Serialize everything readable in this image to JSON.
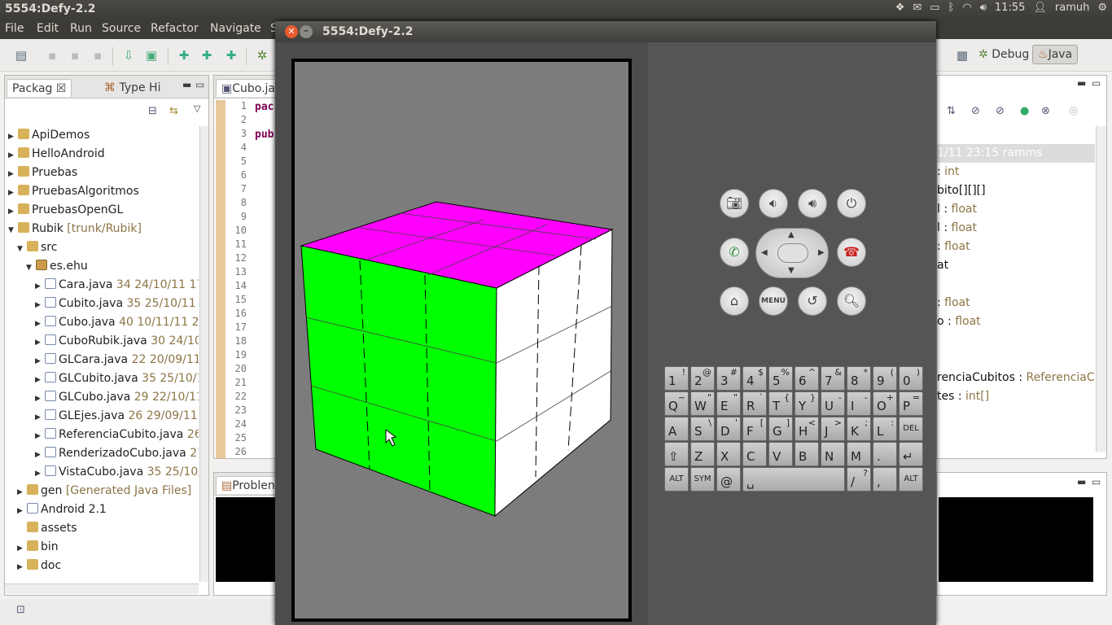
{
  "topbar": {
    "title": "5554:Defy-2.2",
    "clock": "11:55",
    "user": "ramuh"
  },
  "menu": [
    "File",
    "Edit",
    "Run",
    "Source",
    "Refactor",
    "Navigate",
    "S"
  ],
  "perspectives": {
    "debug": "Debug",
    "java": "Java"
  },
  "package_explorer": {
    "tab1": "Packag",
    "tab2": "Type Hi",
    "rows": [
      {
        "indent": 0,
        "twisty": "▶",
        "icon": "fold",
        "label": "ApiDemos",
        "deco": ""
      },
      {
        "indent": 0,
        "twisty": "▶",
        "icon": "fold",
        "label": "HelloAndroid",
        "deco": ""
      },
      {
        "indent": 0,
        "twisty": "▶",
        "icon": "fold",
        "label": "Pruebas",
        "deco": ""
      },
      {
        "indent": 0,
        "twisty": "▶",
        "icon": "fold",
        "label": "PruebasAlgoritmos",
        "deco": ""
      },
      {
        "indent": 0,
        "twisty": "▶",
        "icon": "fold",
        "label": "PruebasOpenGL",
        "deco": ""
      },
      {
        "indent": 0,
        "twisty": "▼",
        "icon": "fold",
        "label": "Rubik",
        "deco": " [trunk/Rubik]"
      },
      {
        "indent": 1,
        "twisty": "▼",
        "icon": "fold",
        "label": "src",
        "deco": ""
      },
      {
        "indent": 2,
        "twisty": "▼",
        "icon": "pkg",
        "label": "es.ehu",
        "deco": ""
      },
      {
        "indent": 3,
        "twisty": "▶",
        "icon": "jv",
        "label": "Cara.java",
        "deco": " 34  24/10/11 17:"
      },
      {
        "indent": 3,
        "twisty": "▶",
        "icon": "jv",
        "label": "Cubito.java",
        "deco": " 35  25/10/11 1"
      },
      {
        "indent": 3,
        "twisty": "▶",
        "icon": "jv",
        "label": "Cubo.java",
        "deco": " 40  10/11/11 23"
      },
      {
        "indent": 3,
        "twisty": "▶",
        "icon": "jv",
        "label": "CuboRubik.java",
        "deco": " 30  24/10,"
      },
      {
        "indent": 3,
        "twisty": "▶",
        "icon": "jv",
        "label": "GLCara.java",
        "deco": " 22  20/09/11"
      },
      {
        "indent": 3,
        "twisty": "▶",
        "icon": "jv",
        "label": "GLCubito.java",
        "deco": " 35  25/10/1"
      },
      {
        "indent": 3,
        "twisty": "▶",
        "icon": "jv",
        "label": "GLCubo.java",
        "deco": " 29  22/10/11"
      },
      {
        "indent": 3,
        "twisty": "▶",
        "icon": "jv",
        "label": "GLEjes.java",
        "deco": " 26  29/09/11 1"
      },
      {
        "indent": 3,
        "twisty": "▶",
        "icon": "jv",
        "label": "ReferenciaCubito.java",
        "deco": " 26"
      },
      {
        "indent": 3,
        "twisty": "▶",
        "icon": "jv",
        "label": "RenderizadoCubo.java",
        "deco": " 27"
      },
      {
        "indent": 3,
        "twisty": "▶",
        "icon": "jv",
        "label": "VistaCubo.java",
        "deco": " 35  25/10/"
      },
      {
        "indent": 1,
        "twisty": "▶",
        "icon": "fold",
        "label": "gen",
        "deco": " [Generated Java Files]"
      },
      {
        "indent": 1,
        "twisty": "▶",
        "icon": "jv",
        "label": "Android 2.1",
        "deco": ""
      },
      {
        "indent": 1,
        "twisty": "",
        "icon": "fold",
        "label": "assets",
        "deco": ""
      },
      {
        "indent": 1,
        "twisty": "▶",
        "icon": "fold",
        "label": "bin",
        "deco": ""
      },
      {
        "indent": 1,
        "twisty": "▶",
        "icon": "fold",
        "label": "doc",
        "deco": ""
      }
    ]
  },
  "editor": {
    "tab": "Cubo.jav",
    "lines": [
      "1",
      "2",
      "3",
      "4",
      "5",
      "6",
      "7",
      "8",
      "9",
      "10",
      "11",
      "12",
      "13",
      "14",
      "15",
      "16",
      "17",
      "18",
      "19",
      "20",
      "21",
      "22",
      "23",
      "24",
      "25",
      "26"
    ],
    "code_line1": "pac",
    "code_line3": "pub"
  },
  "problems": {
    "tab": "Problen"
  },
  "emulator": {
    "title": "5554:Defy-2.2",
    "menu_label": "MENU",
    "colors": {
      "top": "#ff00ff",
      "front": "#00ff00",
      "side": "#ffffff"
    }
  },
  "keyboard": {
    "row1": [
      [
        "1",
        "!"
      ],
      [
        "2",
        "@"
      ],
      [
        "3",
        "#"
      ],
      [
        "4",
        "$"
      ],
      [
        "5",
        "%"
      ],
      [
        "6",
        "^"
      ],
      [
        "7",
        "&"
      ],
      [
        "8",
        "*"
      ],
      [
        "9",
        "("
      ],
      [
        "0",
        ")"
      ]
    ],
    "row2": [
      [
        "Q",
        "~"
      ],
      [
        "W",
        "\""
      ],
      [
        "E",
        "\""
      ],
      [
        "R",
        "`"
      ],
      [
        "T",
        "{"
      ],
      [
        "Y",
        "}"
      ],
      [
        "U",
        "-"
      ],
      [
        "I",
        "-"
      ],
      [
        "O",
        "+"
      ],
      [
        "P",
        "="
      ]
    ],
    "row3": [
      [
        "A",
        ""
      ],
      [
        "S",
        "\\"
      ],
      [
        "D",
        "'"
      ],
      [
        "F",
        "["
      ],
      [
        "G",
        "]"
      ],
      [
        "H",
        "<"
      ],
      [
        "J",
        ">"
      ],
      [
        "K",
        ";"
      ],
      [
        "L",
        ":"
      ],
      [
        "DEL",
        ""
      ]
    ],
    "row4": [
      [
        "⇧",
        ""
      ],
      [
        "Z",
        ""
      ],
      [
        "X",
        ""
      ],
      [
        "C",
        ""
      ],
      [
        "V",
        ""
      ],
      [
        "B",
        ""
      ],
      [
        "N",
        ""
      ],
      [
        "M",
        ""
      ],
      [
        ".",
        ""
      ],
      [
        "↵",
        ""
      ]
    ],
    "row5": {
      "alt": "ALT",
      "sym": "SYM",
      "at": "@",
      "space": "␣",
      "slash": "/",
      "q": "?",
      "comma": ",",
      "alt2": "ALT"
    }
  },
  "outline": {
    "rows": [
      {
        "name": "1/11 23:15  ramms",
        "type": "",
        "hl": true
      },
      {
        "name": ": ",
        "type": "int"
      },
      {
        "name": "bito[][][]",
        "type": ""
      },
      {
        "name": "l : ",
        "type": "float"
      },
      {
        "name": "l : ",
        "type": "float"
      },
      {
        "name": ": ",
        "type": "float"
      },
      {
        "name": "at",
        "type": ""
      },
      {
        "name": "",
        "type": ""
      },
      {
        "name": ": ",
        "type": "float"
      },
      {
        "name": "o : ",
        "type": "float"
      },
      {
        "name": "",
        "type": ""
      },
      {
        "name": "",
        "type": ""
      },
      {
        "name": "renciaCubitos : ",
        "type": "ReferenciaCul"
      },
      {
        "name": "tes : ",
        "type": "int[]"
      }
    ]
  }
}
